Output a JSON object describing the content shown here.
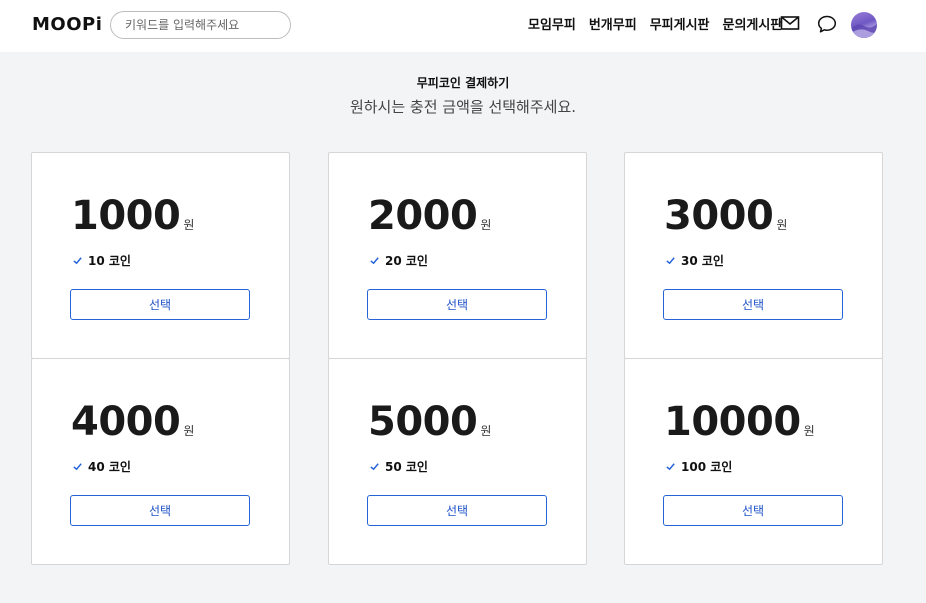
{
  "header": {
    "logo": "MOOPi",
    "search_placeholder": "키워드를 입력해주세요",
    "nav": [
      "모임무피",
      "번개무피",
      "무피게시판",
      "문의게시판"
    ]
  },
  "page": {
    "title": "무피코인 결제하기",
    "subtitle": "원하시는 충전 금액을 선택해주세요."
  },
  "plans": [
    {
      "amount": "1000",
      "unit": "원",
      "coins": "10 코인",
      "button": "선택"
    },
    {
      "amount": "2000",
      "unit": "원",
      "coins": "20 코인",
      "button": "선택"
    },
    {
      "amount": "3000",
      "unit": "원",
      "coins": "30 코인",
      "button": "선택"
    },
    {
      "amount": "4000",
      "unit": "원",
      "coins": "40 코인",
      "button": "선택"
    },
    {
      "amount": "5000",
      "unit": "원",
      "coins": "50 코인",
      "button": "선택"
    },
    {
      "amount": "10000",
      "unit": "원",
      "coins": "100 코인",
      "button": "선택"
    }
  ],
  "icons": {
    "mail": "mail-icon",
    "chat": "chat-icon",
    "check": "check-icon"
  },
  "colors": {
    "accent": "#2563d9",
    "background": "#f3f4f6"
  }
}
